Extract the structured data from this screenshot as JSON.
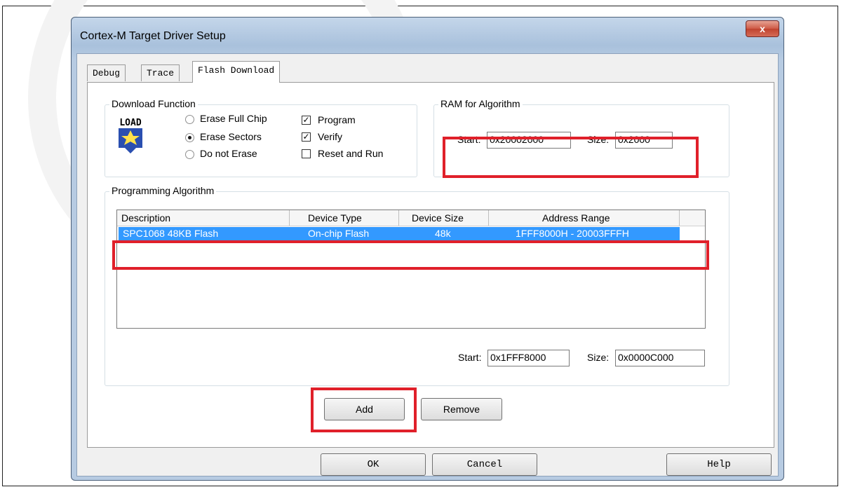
{
  "window": {
    "title": "Cortex-M Target Driver Setup",
    "close_glyph": "x"
  },
  "tabs": [
    {
      "label": "Debug",
      "active": false
    },
    {
      "label": "Trace",
      "active": false
    },
    {
      "label": "Flash Download",
      "active": true
    }
  ],
  "download_function": {
    "title": "Download Function",
    "icon_text": "LOAD",
    "radios": [
      {
        "label": "Erase Full Chip",
        "checked": false
      },
      {
        "label": "Erase Sectors",
        "checked": true
      },
      {
        "label": "Do not Erase",
        "checked": false
      }
    ],
    "checkboxes": [
      {
        "label": "Program",
        "checked": true
      },
      {
        "label": "Verify",
        "checked": true
      },
      {
        "label": "Reset and Run",
        "checked": false
      }
    ]
  },
  "ram_for_algorithm": {
    "title": "RAM for Algorithm",
    "start_label": "Start:",
    "start_value": "0x20002000",
    "size_label": "Size:",
    "size_value": "0x2000"
  },
  "programming_algorithm": {
    "title": "Programming Algorithm",
    "columns": [
      "Description",
      "Device Type",
      "Device Size",
      "Address Range"
    ],
    "rows": [
      {
        "description": "SPC1068 48KB Flash",
        "device_type": "On-chip Flash",
        "device_size": "48k",
        "address_range": "1FFF8000H - 20003FFFH"
      }
    ],
    "start_label": "Start:",
    "start_value": "0x1FFF8000",
    "size_label": "Size:",
    "size_value": "0x0000C000"
  },
  "buttons": {
    "add": "Add",
    "remove": "Remove",
    "ok": "OK",
    "cancel": "Cancel",
    "help": "Help"
  },
  "colors": {
    "highlight_red": "#e0202a",
    "selection_blue": "#3399ff"
  }
}
